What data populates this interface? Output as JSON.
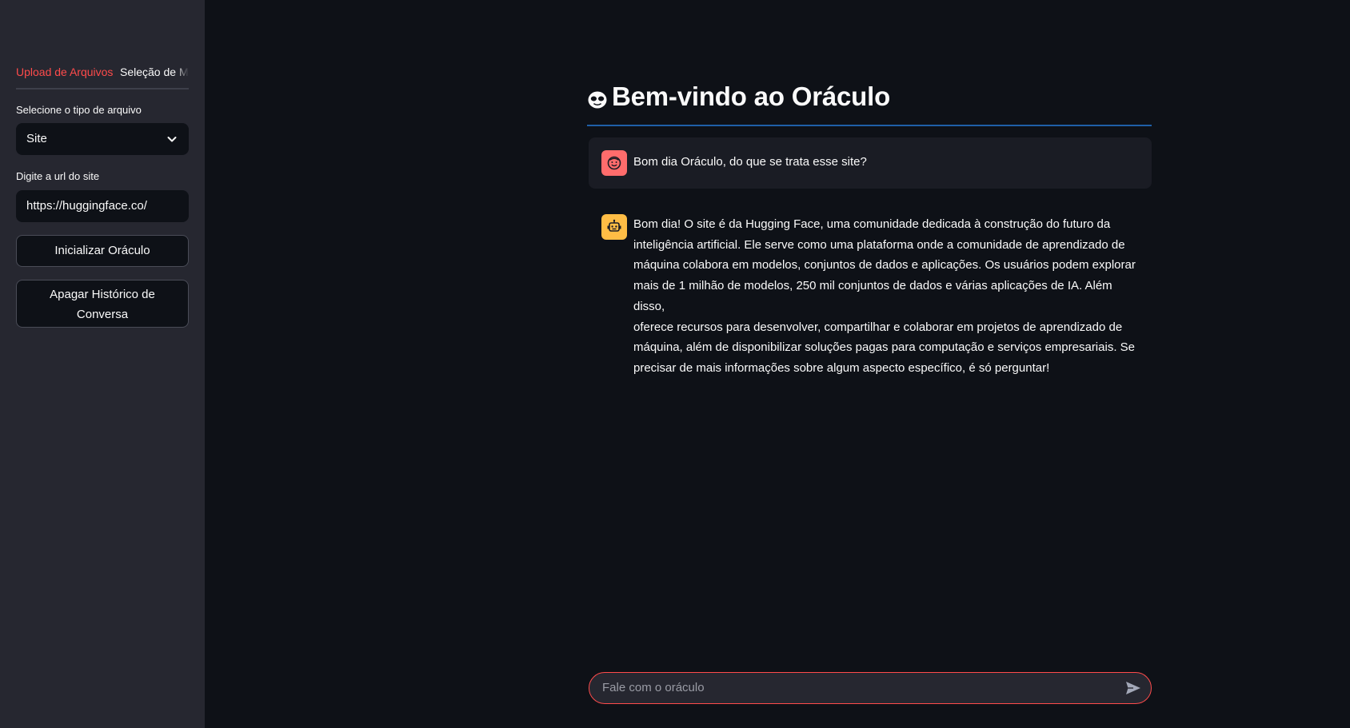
{
  "sidebar": {
    "tabs": [
      {
        "label": "Upload de Arquivos",
        "active": true
      },
      {
        "label": "Seleção de Modelos",
        "active": false
      }
    ],
    "file_type_label": "Selecione o tipo de arquivo",
    "file_type_value": "Site",
    "url_label": "Digite a url do site",
    "url_value": "https://huggingface.co/",
    "init_button": "Inicializar Oráculo",
    "clear_button_line1": "Apagar Histórico de",
    "clear_button_line2": "Conversa"
  },
  "main": {
    "title": "Bem-vindo ao Oráculo",
    "messages": [
      {
        "role": "user",
        "text": "Bom dia Oráculo, do que se trata esse site?"
      },
      {
        "role": "assistant",
        "lines": [
          "Bom dia! O site é da Hugging Face, uma comunidade dedicada à construção do futuro da",
          "inteligência artificial. Ele serve como uma plataforma onde a comunidade de aprendizado de",
          "máquina colabora em modelos, conjuntos de dados e aplicações. Os usuários podem explorar",
          "mais de 1 milhão de modelos, 250 mil conjuntos de dados e várias aplicações de IA. Além disso,",
          "oferece recursos para desenvolver, compartilhar e colaborar em projetos de aprendizado de",
          "máquina, além de disponibilizar soluções pagas para computação e serviços empresariais. Se",
          "precisar de mais informações sobre algum aspecto específico, é só perguntar!"
        ]
      }
    ],
    "chat_placeholder": "Fale com o oráculo"
  },
  "colors": {
    "background": "#0e1117",
    "sidebar": "#262730",
    "accent": "#ff4b4b",
    "user_avatar": "#ff6c6c",
    "bot_avatar": "#ffbd45",
    "title_divider": "#1f5fa8"
  },
  "icons": {
    "title": "alien-icon",
    "user_avatar": "face-icon",
    "bot_avatar": "robot-icon",
    "select": "chevron-down-icon",
    "send": "send-icon"
  }
}
